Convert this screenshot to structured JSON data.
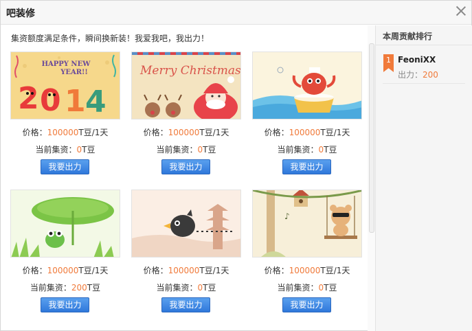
{
  "dialog": {
    "title": "吧装修",
    "close_icon": "close-icon"
  },
  "notice": "集资额度满足条件，瞬间换新装！我爱我吧，我出力！",
  "cards": [
    {
      "price_label": "价格：",
      "price_value": "100000",
      "price_unit": "T豆/1天",
      "raised_label": "当前集资：",
      "raised_value": "0",
      "raised_unit": "T豆",
      "button": "我要出力",
      "thumb": "happy-new-year-2014"
    },
    {
      "price_label": "价格：",
      "price_value": "100000",
      "price_unit": "T豆/1天",
      "raised_label": "当前集资：",
      "raised_value": "0",
      "raised_unit": "T豆",
      "button": "我要出力",
      "thumb": "merry-christmas",
      "thumb_text": "Merry Christmas"
    },
    {
      "price_label": "价格：",
      "price_value": "100000",
      "price_unit": "T豆/1天",
      "raised_label": "当前集资：",
      "raised_value": "0",
      "raised_unit": "T豆",
      "button": "我要出力",
      "thumb": "crab-in-tub"
    },
    {
      "price_label": "价格：",
      "price_value": "100000",
      "price_unit": "T豆/1天",
      "raised_label": "当前集资：",
      "raised_value": "200",
      "raised_unit": "T豆",
      "button": "我要出力",
      "thumb": "frog-lotus-leaf"
    },
    {
      "price_label": "价格：",
      "price_value": "100000",
      "price_unit": "T豆/1天",
      "raised_label": "当前集资：",
      "raised_value": "0",
      "raised_unit": "T豆",
      "button": "我要出力",
      "thumb": "bird-pagoda"
    },
    {
      "price_label": "价格：",
      "price_value": "100000",
      "price_unit": "T豆/1天",
      "raised_label": "当前集资：",
      "raised_value": "0",
      "raised_unit": "T豆",
      "button": "我要出力",
      "thumb": "bear-swing"
    }
  ],
  "sidebar": {
    "title": "本周贡献排行",
    "ranks": [
      {
        "rank": "1",
        "name": "FeoniXX",
        "amount_label": "出力：",
        "amount_value": "200"
      }
    ]
  },
  "colors": {
    "accent": "#f07a3a",
    "button": "#3a86e3"
  }
}
